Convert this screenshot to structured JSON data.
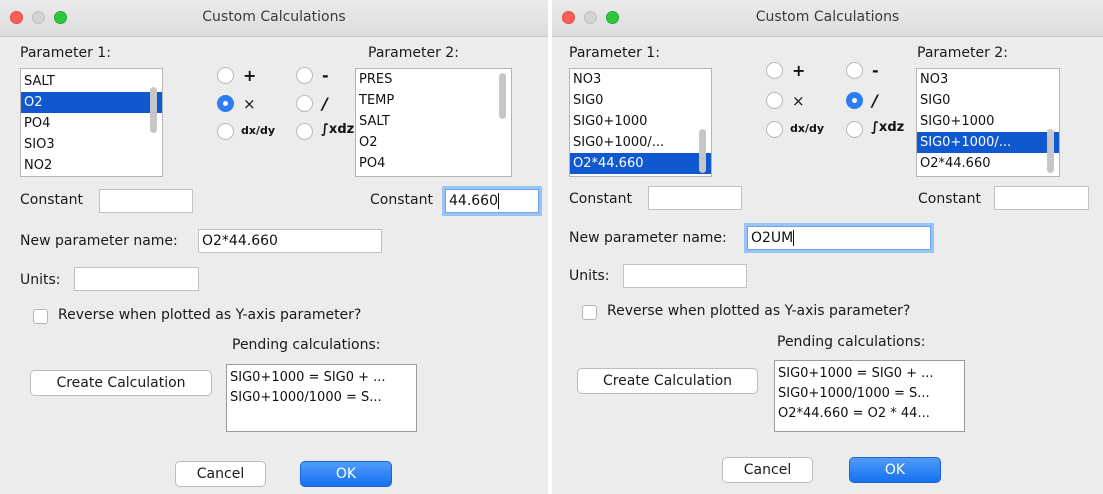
{
  "windows": [
    {
      "title": "Custom Calculations",
      "param1_label": "Parameter 1:",
      "param1_items": [
        "SALT",
        "O2",
        "PO4",
        "SIO3",
        "NO2"
      ],
      "param1_selected": "O2",
      "operators": {
        "plus": "+",
        "minus": "-",
        "times": "×",
        "divide": "/",
        "deriv": "dx/dy",
        "integral": "∫xdz"
      },
      "operator_selected": "times",
      "param2_label": "Parameter 2:",
      "param2_items": [
        "PRES",
        "TEMP",
        "SALT",
        "O2",
        "PO4"
      ],
      "constant_label": "Constant",
      "constant1_value": "",
      "constant2_value": "44.660",
      "new_param_label": "New parameter name:",
      "new_param_value": "O2*44.660",
      "units_label": "Units:",
      "units_value": "",
      "reverse_label": "Reverse when plotted as Y-axis parameter?",
      "reverse_checked": false,
      "pending_label": "Pending calculations:",
      "pending_items": [
        "SIG0+1000 = SIG0 + ...",
        "SIG0+1000/1000 = S..."
      ],
      "create_button": "Create Calculation",
      "cancel_button": "Cancel",
      "ok_button": "OK"
    },
    {
      "title": "Custom Calculations",
      "param1_label": "Parameter 1:",
      "param1_items": [
        "NO3",
        "SIG0",
        "SIG0+1000",
        "SIG0+1000/...",
        "O2*44.660"
      ],
      "param1_selected": "O2*44.660",
      "operators": {
        "plus": "+",
        "minus": "-",
        "times": "×",
        "divide": "/",
        "deriv": "dx/dy",
        "integral": "∫xdz"
      },
      "operator_selected": "divide",
      "param2_label": "Parameter 2:",
      "param2_items": [
        "NO3",
        "SIG0",
        "SIG0+1000",
        "SIG0+1000/...",
        "O2*44.660"
      ],
      "param2_selected": "SIG0+1000/...",
      "constant_label": "Constant",
      "constant1_value": "",
      "constant2_value": "",
      "new_param_label": "New parameter name:",
      "new_param_value": "O2UM",
      "units_label": "Units:",
      "units_value": "",
      "reverse_label": "Reverse when plotted as Y-axis parameter?",
      "reverse_checked": false,
      "pending_label": "Pending calculations:",
      "pending_items": [
        "SIG0+1000 = SIG0 + ...",
        "SIG0+1000/1000 = S...",
        "O2*44.660 = O2 * 44..."
      ],
      "create_button": "Create Calculation",
      "cancel_button": "Cancel",
      "ok_button": "OK"
    }
  ],
  "colors": {
    "selection": "#1058d0",
    "accent": "#2d7df5",
    "close": "#fd5f57",
    "zoom": "#2ec840"
  }
}
